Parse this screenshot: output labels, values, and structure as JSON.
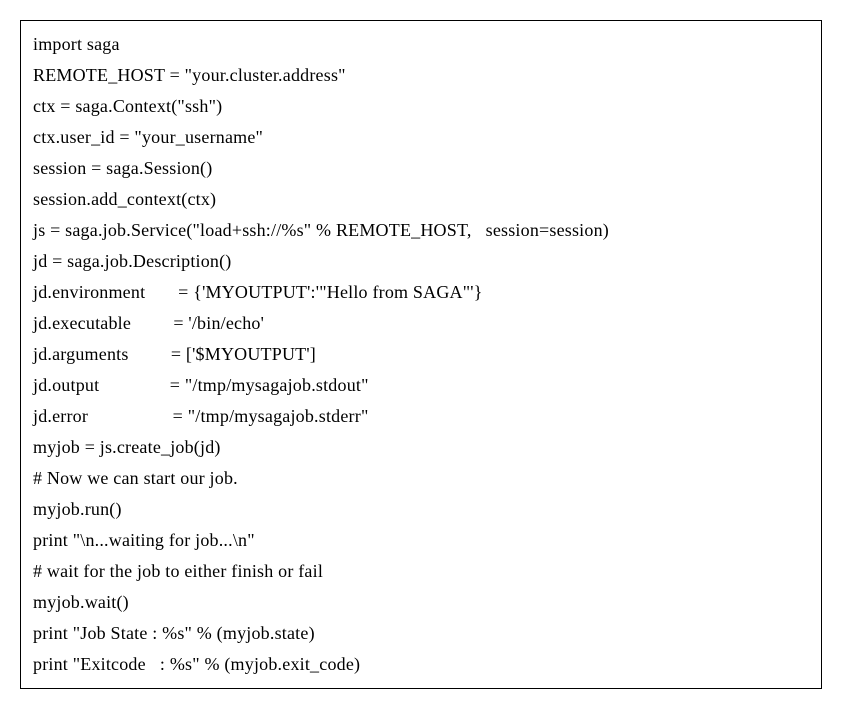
{
  "code": {
    "lines": [
      "import saga",
      "REMOTE_HOST = \"your.cluster.address\"",
      "ctx = saga.Context(\"ssh\")",
      "ctx.user_id = \"your_username\"",
      "session = saga.Session()",
      "session.add_context(ctx)",
      "js = saga.job.Service(\"load+ssh://%s\" % REMOTE_HOST,   session=session)",
      "jd = saga.job.Description()",
      "jd.environment       = {'MYOUTPUT':'\"Hello from SAGA\"'}",
      "jd.executable         = '/bin/echo'",
      "jd.arguments         = ['$MYOUTPUT']",
      "jd.output               = \"/tmp/mysagajob.stdout\"",
      "jd.error                  = \"/tmp/mysagajob.stderr\"",
      "myjob = js.create_job(jd)",
      "# Now we can start our job.",
      "myjob.run()",
      "print \"\\n...waiting for job...\\n\"",
      "# wait for the job to either finish or fail",
      "myjob.wait()",
      "print \"Job State : %s\" % (myjob.state)",
      "print \"Exitcode   : %s\" % (myjob.exit_code)"
    ]
  }
}
